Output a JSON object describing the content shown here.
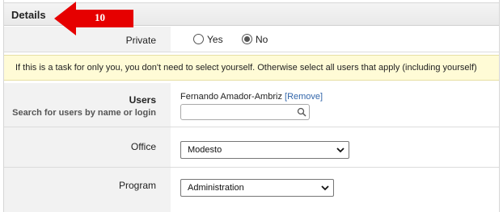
{
  "details": {
    "title": "Details"
  },
  "annotation": {
    "number": "10",
    "arrow_color": "#e60000"
  },
  "private": {
    "label": "Private",
    "options": [
      {
        "label": "Yes",
        "selected": false
      },
      {
        "label": "No",
        "selected": true
      }
    ]
  },
  "notice": {
    "text": "If this is a task for only you, you don't need to select yourself. Otherwise select all users that apply (including yourself)",
    "background": "#fffbd6"
  },
  "users": {
    "label": "Users",
    "sublabel": "Search for users by name or login",
    "selected_user": "Fernando Amador-Ambriz",
    "remove_label": "[Remove]",
    "search_value": ""
  },
  "office": {
    "label": "Office",
    "selected": "Modesto"
  },
  "program": {
    "label": "Program",
    "selected": "Administration"
  },
  "icons": {
    "search": "search-icon",
    "dropdown": "chevron-down-icon"
  }
}
